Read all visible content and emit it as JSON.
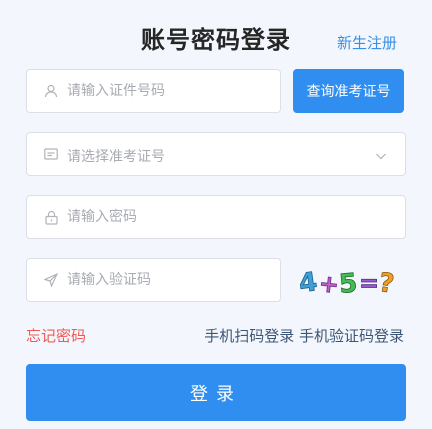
{
  "header": {
    "title": "账号密码登录",
    "register_link": "新生注册"
  },
  "form": {
    "id_field": {
      "placeholder": "请输入证件号码",
      "icon": "user-icon"
    },
    "query_button": "查询准考证号",
    "ticket_select": {
      "placeholder": "请选择准考证号",
      "icon": "card-icon"
    },
    "password_field": {
      "placeholder": "请输入密码",
      "icon": "lock-icon"
    },
    "captcha_field": {
      "placeholder": "请输入验证码",
      "icon": "send-icon"
    },
    "captcha_text": "4+5=?"
  },
  "links": {
    "forgot_password": "忘记密码",
    "qr_login": "手机扫码登录",
    "sms_login": "手机验证码登录"
  },
  "login_button": "登录",
  "colors": {
    "primary": "#2f8ef0",
    "forgot": "#ee5a52",
    "link": "#3b8ee6"
  }
}
